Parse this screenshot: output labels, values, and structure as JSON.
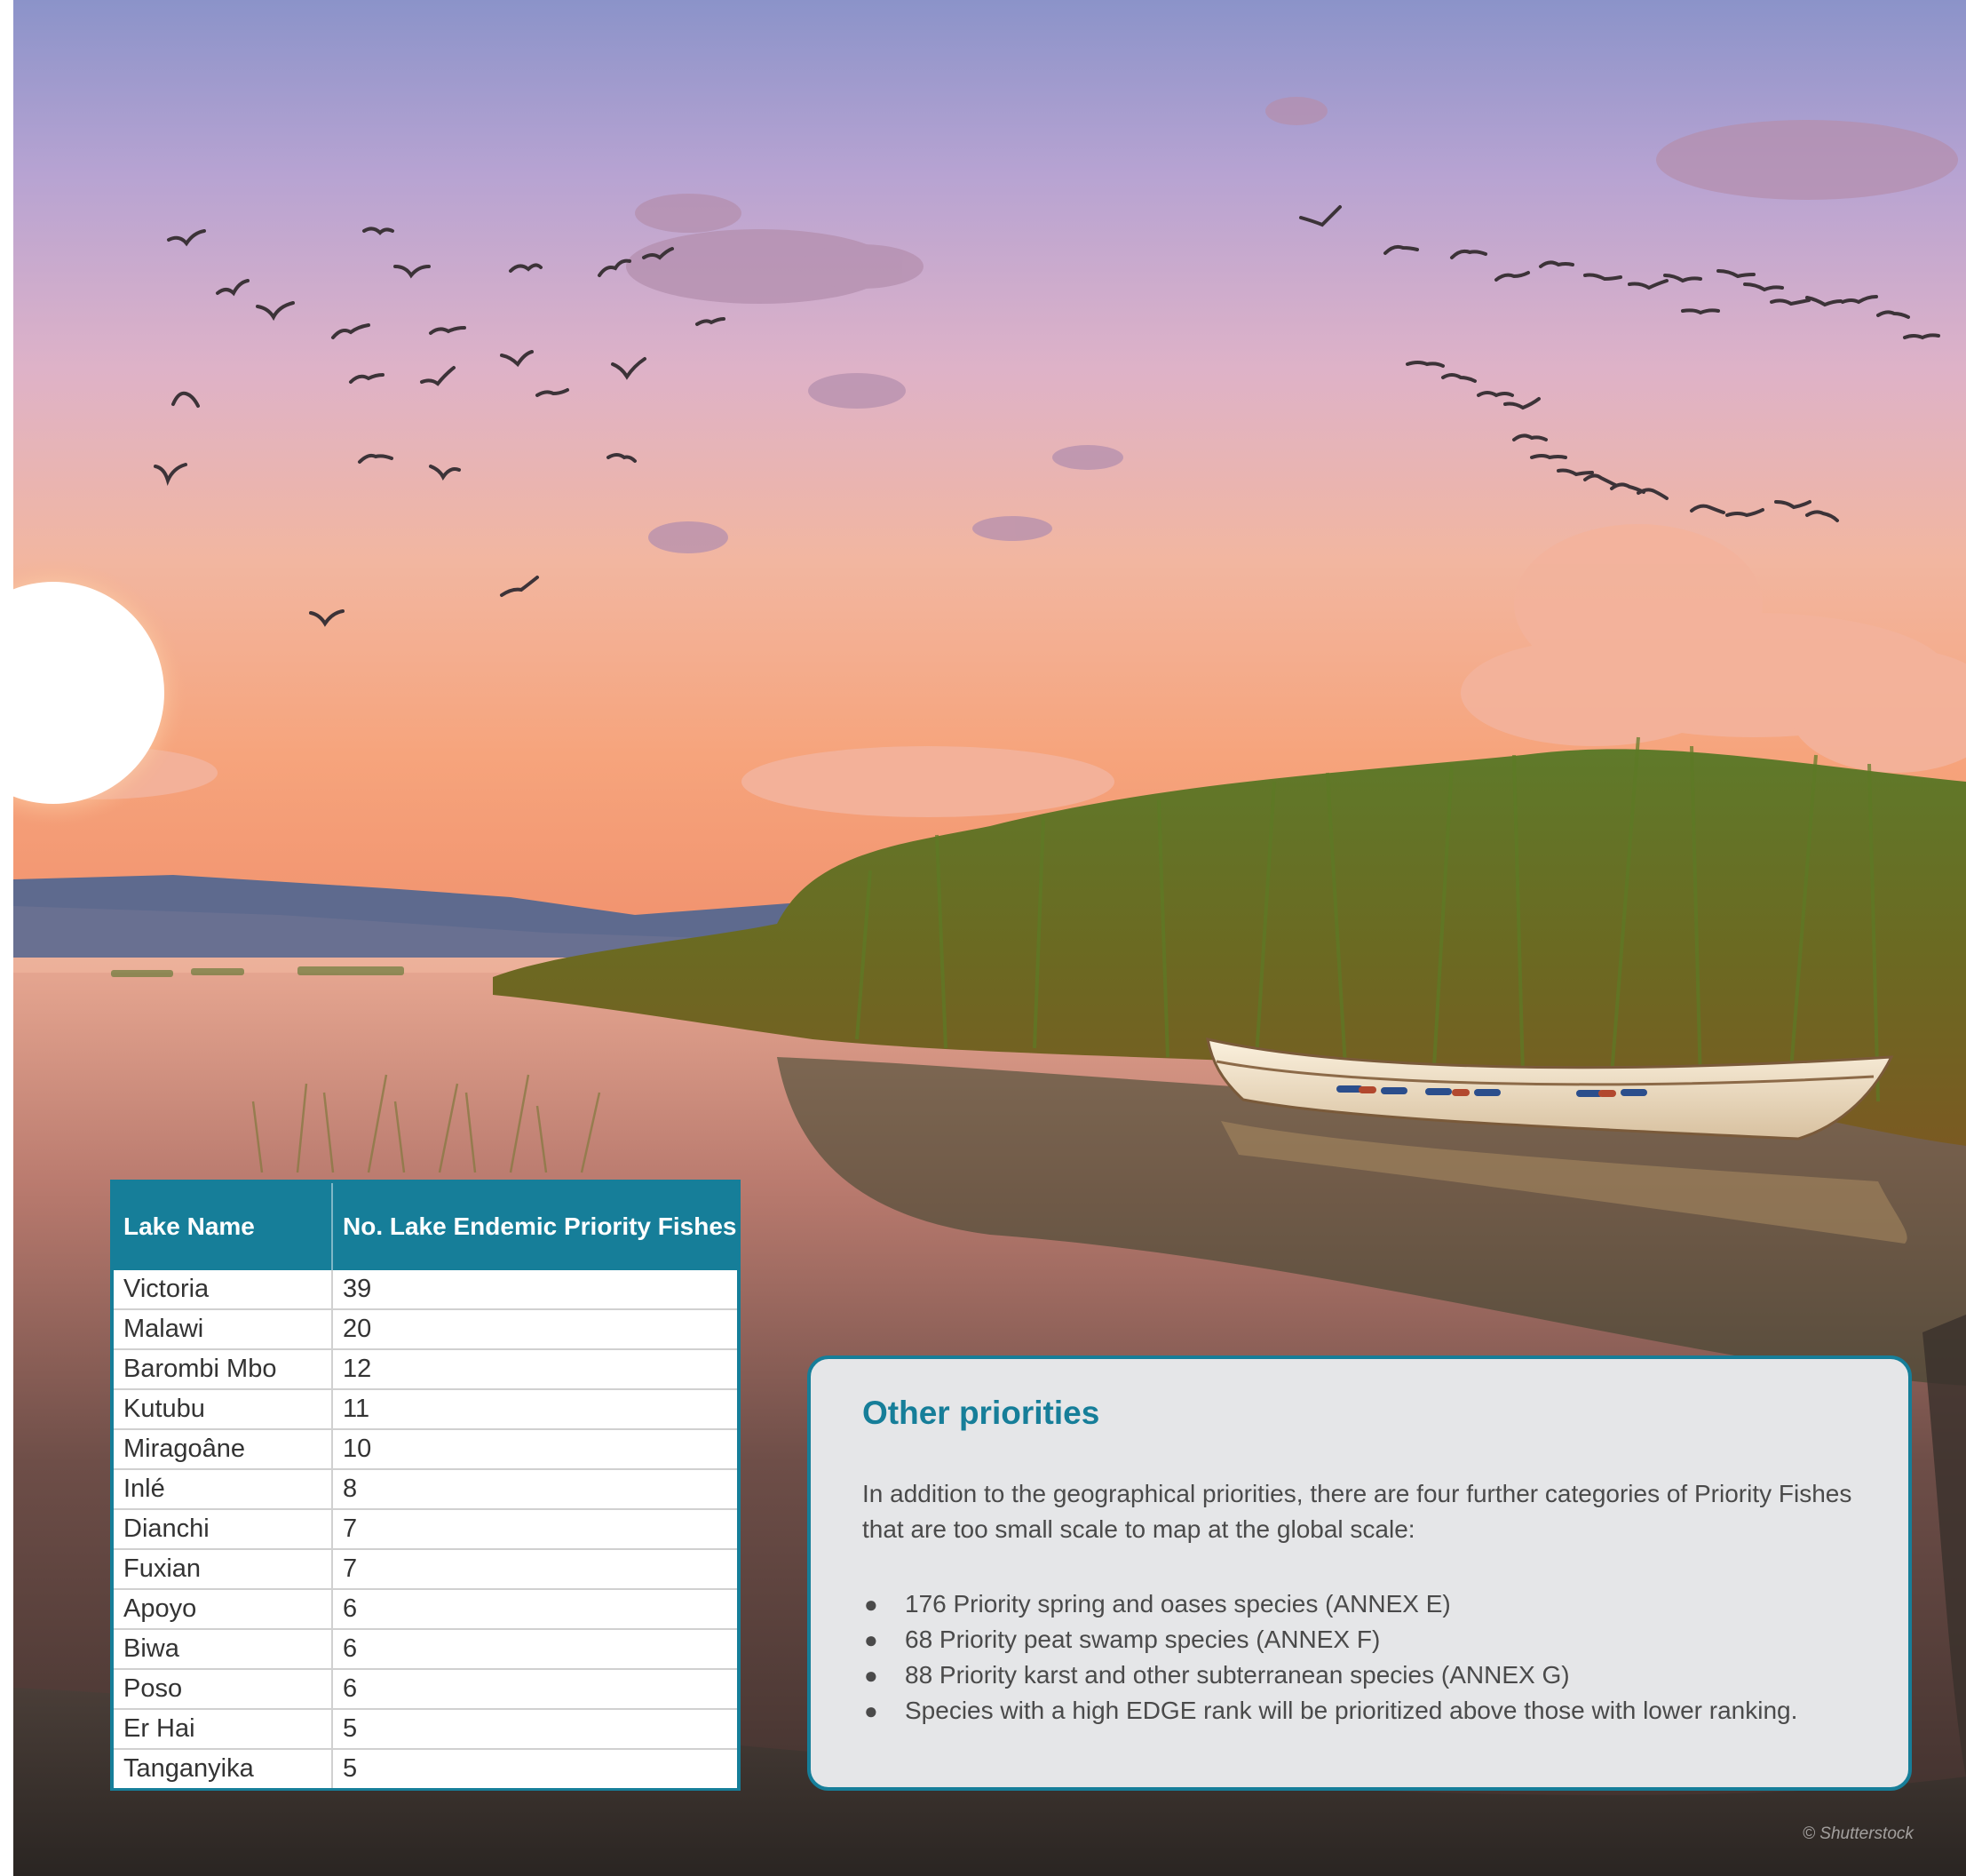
{
  "table": {
    "headers": [
      "Lake Name",
      "No. Lake Endemic Priority Fishes"
    ],
    "rows": [
      [
        "Victoria",
        "39"
      ],
      [
        "Malawi",
        "20"
      ],
      [
        "Barombi Mbo",
        "12"
      ],
      [
        "Kutubu",
        "11"
      ],
      [
        "Miragoâne",
        "10"
      ],
      [
        "Inlé",
        "8"
      ],
      [
        "Dianchi",
        "7"
      ],
      [
        "Fuxian",
        "7"
      ],
      [
        "Apoyo",
        "6"
      ],
      [
        "Biwa",
        "6"
      ],
      [
        "Poso",
        "6"
      ],
      [
        "Er Hai",
        "5"
      ],
      [
        "Tanganyika",
        "5"
      ]
    ]
  },
  "priorities": {
    "title": "Other priorities",
    "intro": "In addition to the geographical priorities, there are four further categories of Priority Fishes that are too small scale to map at the global scale:",
    "items": [
      "176 Priority spring and oases species (ANNEX E)",
      "68 Priority peat swamp species (ANNEX F)",
      "88 Priority karst and other subterranean species (ANNEX G)",
      "Species with a high EDGE rank will be prioritized above those with lower ranking."
    ]
  },
  "photo": {
    "credit": "© Shutterstock",
    "icons": [
      "sun",
      "bird-flock",
      "reeds",
      "rowing-boat",
      "mountains",
      "lake"
    ]
  },
  "colors": {
    "accent": "#167e99",
    "box_background": "#e5e6e8",
    "text": "#4a4a4a"
  }
}
